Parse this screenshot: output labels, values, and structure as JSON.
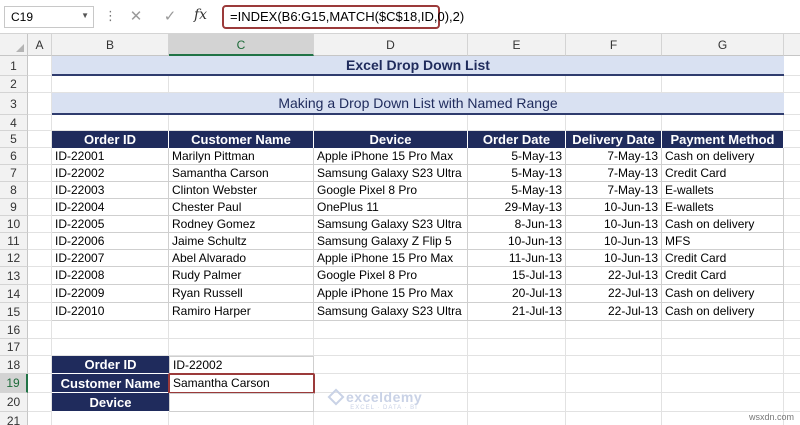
{
  "formula_bar": {
    "name_box": "C19",
    "dots": "⋮",
    "cancel_icon": "✕",
    "enter_icon": "✓",
    "fx_label": "fx",
    "formula": "=INDEX(B6:G15,MATCH($C$18,ID,0),2)"
  },
  "columns": [
    "A",
    "B",
    "C",
    "D",
    "E",
    "F",
    "G"
  ],
  "rows": [
    "1",
    "2",
    "3",
    "4",
    "5",
    "6",
    "7",
    "8",
    "9",
    "10",
    "11",
    "12",
    "13",
    "14",
    "15",
    "16",
    "17",
    "18",
    "19",
    "20",
    "21"
  ],
  "title": "Excel Drop Down List",
  "subtitle": "Making a Drop Down List with Named Range",
  "table": {
    "headers": [
      "Order ID",
      "Customer Name",
      "Device",
      "Order Date",
      "Delivery Date",
      "Payment Method"
    ],
    "rows": [
      [
        "ID-22001",
        "Marilyn Pittman",
        "Apple iPhone 15 Pro Max",
        "5-May-13",
        "7-May-13",
        "Cash on delivery"
      ],
      [
        "ID-22002",
        "Samantha Carson",
        "Samsung Galaxy S23 Ultra",
        "5-May-13",
        "7-May-13",
        "Credit Card"
      ],
      [
        "ID-22003",
        "Clinton Webster",
        "Google Pixel 8 Pro",
        "5-May-13",
        "7-May-13",
        "E-wallets"
      ],
      [
        "ID-22004",
        "Chester Paul",
        "OnePlus 11",
        "29-May-13",
        "10-Jun-13",
        "E-wallets"
      ],
      [
        "ID-22005",
        "Rodney Gomez",
        "Samsung Galaxy S23 Ultra",
        "8-Jun-13",
        "10-Jun-13",
        "Cash on delivery"
      ],
      [
        "ID-22006",
        "Jaime Schultz",
        "Samsung Galaxy Z Flip 5",
        "10-Jun-13",
        "10-Jun-13",
        "MFS"
      ],
      [
        "ID-22007",
        "Abel Alvarado",
        "Apple iPhone 15 Pro Max",
        "11-Jun-13",
        "10-Jun-13",
        "Credit Card"
      ],
      [
        "ID-22008",
        "Rudy Palmer",
        "Google Pixel 8 Pro",
        "15-Jul-13",
        "22-Jul-13",
        "Credit Card"
      ],
      [
        "ID-22009",
        "Ryan Russell",
        "Apple iPhone 15 Pro Max",
        "20-Jul-13",
        "22-Jul-13",
        "Cash on delivery"
      ],
      [
        "ID-22010",
        "Ramiro Harper",
        "Samsung Galaxy S23 Ultra",
        "21-Jul-13",
        "22-Jul-13",
        "Cash on delivery"
      ]
    ]
  },
  "lookup": {
    "order_id_label": "Order ID",
    "order_id_value": "ID-22002",
    "customer_label": "Customer Name",
    "customer_value": "Samantha Carson",
    "device_label": "Device",
    "device_value": ""
  },
  "watermark": {
    "name": "exceldemy",
    "sub": "EXCEL · DATA · BI"
  },
  "site": "wsxdn.com",
  "colors": {
    "header_navy": "#1f2b5c",
    "banner_bg": "#d9e1f2",
    "highlight": "#9b3a3a"
  }
}
